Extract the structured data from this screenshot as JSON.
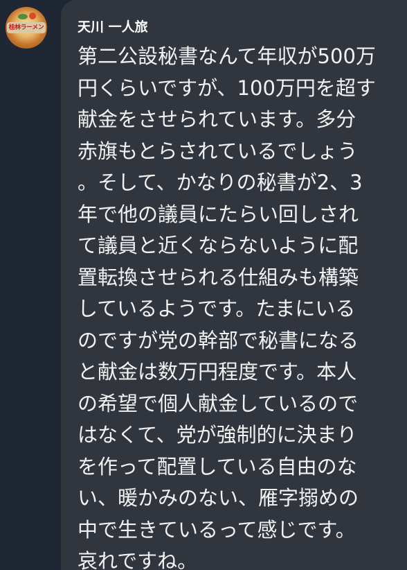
{
  "message": {
    "sender": "天川 一人旅",
    "avatar_label": "桂林ラーメン",
    "avatar_icon": "ramen-bowl-icon",
    "lines": [
      "第二公設秘書なんて年収が500万",
      "円くらいですが、100万円を超す",
      "献金をさせられています。多分",
      "赤旗もとらされているでしょう",
      "。そして、かなりの秘書が2、3",
      "年で他の議員にたらい回しされ",
      "て議員と近くならないように配",
      "置転換させられる仕組みも構築",
      "しているようです。たまにいる",
      "のですが党の幹部で秘書になる",
      "と献金は数万円程度です。本人",
      "の希望で個人献金しているので",
      "はなくて、党が強制的に決まり",
      "を作って配置している自由のな",
      "い、暖かみのない、雁字搦めの",
      "中で生きているって感じです。",
      "哀れですね。"
    ]
  },
  "colors": {
    "background": "#1f2734",
    "bubble": "#31353d",
    "text": "#f2f2f2"
  }
}
